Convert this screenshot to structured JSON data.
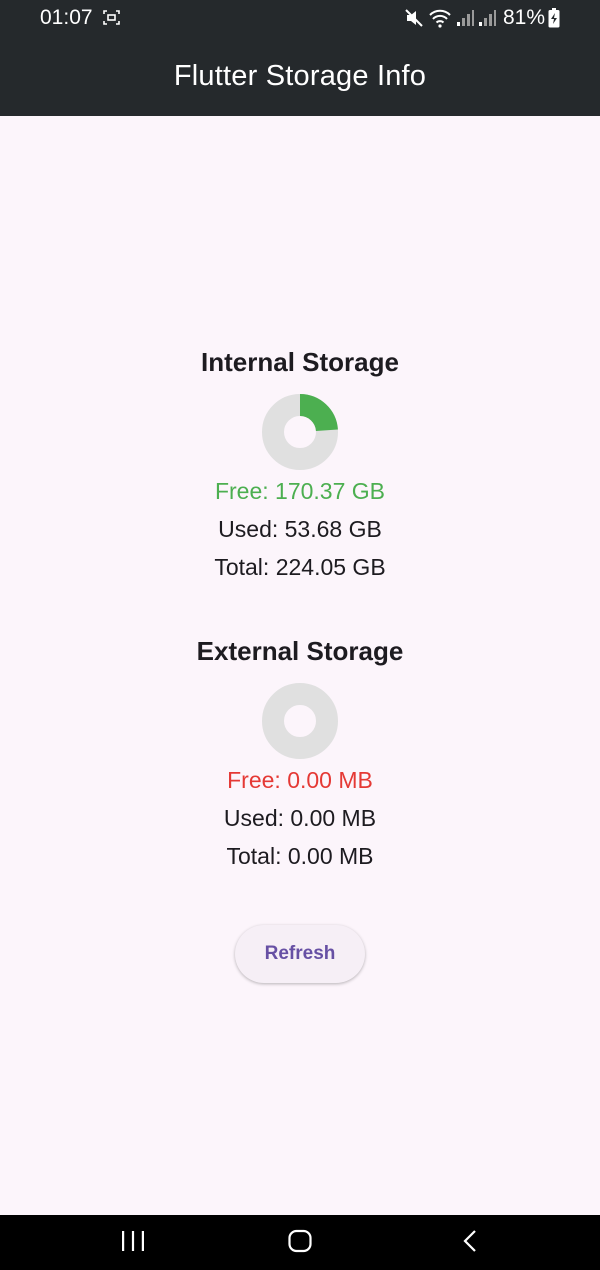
{
  "status_bar": {
    "time": "01:07",
    "battery_percent": "81%",
    "icons": [
      "screenshot-icon",
      "mute-icon",
      "wifi-icon",
      "signal-icon",
      "signal-icon",
      "battery-charging-icon"
    ]
  },
  "app_bar": {
    "title": "Flutter Storage Info",
    "background": "#25292c"
  },
  "internal": {
    "title": "Internal Storage",
    "free_text": "Free: 170.37 GB",
    "used_text": "Used: 53.68 GB",
    "total_text": "Total: 224.05 GB",
    "free_gb": 170.37,
    "used_gb": 53.68,
    "total_gb": 224.05,
    "free_color": "#4caf50"
  },
  "external": {
    "title": "External Storage",
    "free_text": "Free: 0.00 MB",
    "used_text": "Used: 0.00 MB",
    "total_text": "Total: 0.00 MB",
    "free_mb": 0.0,
    "used_mb": 0.0,
    "total_mb": 0.0,
    "free_color": "#e53935"
  },
  "refresh_label": "Refresh",
  "colors": {
    "background": "#fcf5fb",
    "donut_track": "#e0e0e0",
    "donut_used": "#4caf50",
    "accent": "#6750a4"
  },
  "nav_bar": {
    "icons": [
      "recent-apps-icon",
      "home-icon",
      "back-icon"
    ]
  }
}
